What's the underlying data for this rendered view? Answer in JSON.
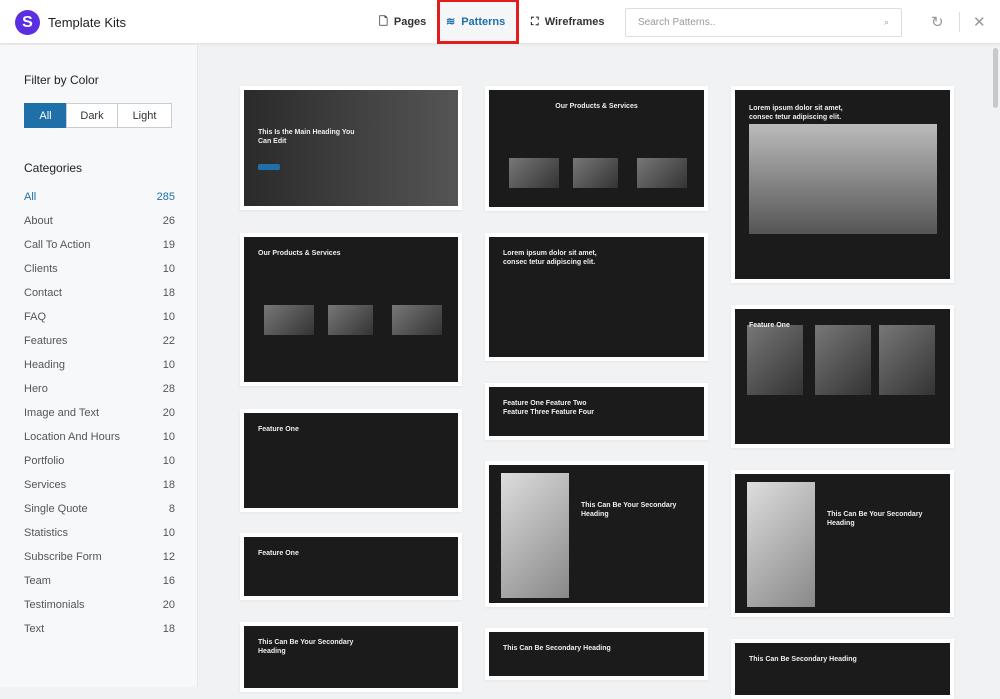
{
  "header": {
    "logo_glyph": "S",
    "title": "Template Kits",
    "tabs": [
      {
        "label": "Pages",
        "icon": "page-icon"
      },
      {
        "label": "Patterns",
        "icon": "layers-icon"
      },
      {
        "label": "Wireframes",
        "icon": "frame-icon"
      }
    ],
    "active_tab": "Patterns",
    "search_placeholder": "Search Patterns..",
    "accent": "#1f6fa8"
  },
  "sidebar": {
    "filter_title": "Filter by Color",
    "filters": [
      "All",
      "Dark",
      "Light"
    ],
    "active_filter": "All",
    "categories_title": "Categories",
    "categories": [
      {
        "name": "All",
        "count": "285"
      },
      {
        "name": "About",
        "count": "26"
      },
      {
        "name": "Call To Action",
        "count": "19"
      },
      {
        "name": "Clients",
        "count": "10"
      },
      {
        "name": "Contact",
        "count": "18"
      },
      {
        "name": "FAQ",
        "count": "10"
      },
      {
        "name": "Features",
        "count": "22"
      },
      {
        "name": "Heading",
        "count": "10"
      },
      {
        "name": "Hero",
        "count": "28"
      },
      {
        "name": "Image and Text",
        "count": "20"
      },
      {
        "name": "Location And Hours",
        "count": "10"
      },
      {
        "name": "Portfolio",
        "count": "10"
      },
      {
        "name": "Services",
        "count": "18"
      },
      {
        "name": "Single Quote",
        "count": "8"
      },
      {
        "name": "Statistics",
        "count": "10"
      },
      {
        "name": "Subscribe Form",
        "count": "12"
      },
      {
        "name": "Team",
        "count": "16"
      },
      {
        "name": "Testimonials",
        "count": "20"
      },
      {
        "name": "Text",
        "count": "18"
      }
    ]
  },
  "patterns": [
    {
      "heading": "This Is the Main Heading You Can Edit"
    },
    {
      "heading": "Our Products & Services"
    },
    {
      "heading": "Lorem ipsum dolor sit amet, consec tetur adipiscing elit."
    },
    {
      "heading": "Our Products & Services"
    },
    {
      "heading": "Lorem ipsum dolor sit amet, consec tetur adipiscing elit."
    },
    {
      "heading": "Feature One"
    },
    {
      "heading": "Feature One   Feature Two   Feature Three   Feature Four"
    },
    {
      "heading": "Feature One"
    },
    {
      "heading": "This Can Be Your Secondary Heading"
    },
    {
      "heading": "Feature One"
    },
    {
      "heading": "This Can Be Your Secondary Heading"
    },
    {
      "heading": "This Can Be Your Secondary Heading"
    },
    {
      "heading": "This Can Be Secondary Heading"
    },
    {
      "heading": "This Can Be Secondary Heading"
    }
  ]
}
